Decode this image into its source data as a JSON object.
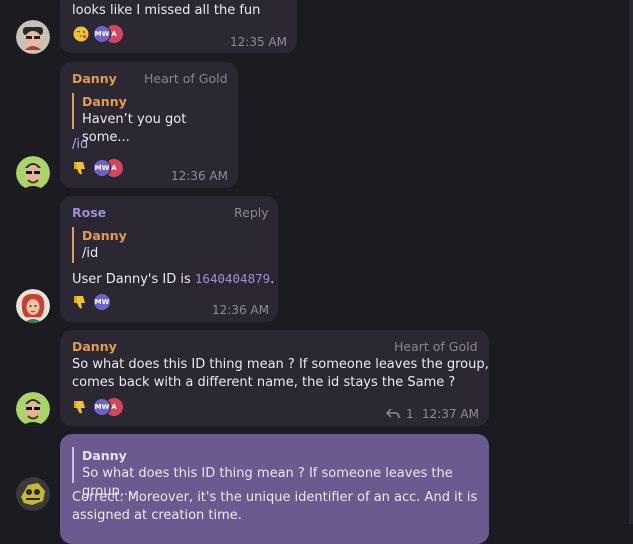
{
  "messages": [
    {
      "text": "looks like I missed all the fun",
      "reactions": {
        "emoji_icon": "kissing-face-icon",
        "avatars": [
          "MW",
          "A"
        ]
      },
      "time": "12:35 AM"
    },
    {
      "sender": "Danny",
      "tag": "Heart of Gold",
      "quote": {
        "sender": "Danny",
        "text": "Haven’t you got some..."
      },
      "text": "/id",
      "reactions": {
        "emoji_icon": "thumbs-down-icon",
        "avatars": [
          "MW",
          "A"
        ]
      },
      "time": "12:36 AM"
    },
    {
      "sender": "Rose",
      "tag": "Reply",
      "quote": {
        "sender": "Danny",
        "text": "/id"
      },
      "text_prefix": "User Danny's ID is ",
      "user_id": "1640404879",
      "text_suffix": ".",
      "reactions": {
        "emoji_icon": "thumbs-down-icon",
        "avatars": [
          "MW"
        ]
      },
      "time": "12:36 AM"
    },
    {
      "sender": "Danny",
      "tag": "Heart of Gold",
      "text_line1": "So what does this ID thing mean ? If someone leaves the group,",
      "text_line2": "comes back with a different name, the id stays the Same ?",
      "reactions": {
        "emoji_icon": "thumbs-down-icon",
        "avatars": [
          "MW",
          "A"
        ]
      },
      "reply_count": "1",
      "time": "12:37 AM"
    },
    {
      "quote": {
        "sender": "Danny",
        "text": "So what does this ID thing mean ? If someone leaves the group,..."
      },
      "text_line1": "Correct. Moreover, it's the unique identifier of an acc. And it is",
      "text_line2": "assigned at creation time."
    }
  ],
  "colors": {
    "background": "#1d1b22",
    "bubble": "#2b2833",
    "own_bubble": "#6a5a8f",
    "danny": "#e39a55",
    "rose": "#a58cd9"
  }
}
